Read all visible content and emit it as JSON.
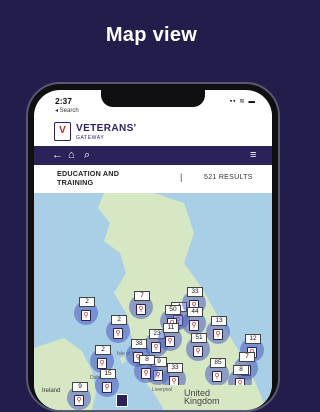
{
  "page_title": "Map view",
  "status_bar": {
    "time": "2:37",
    "back_label": "◂ Search",
    "icons": "▪▪ ≋ ▬"
  },
  "brand": {
    "name": "VETERANS'",
    "sub": "GATEWAY"
  },
  "nav": {
    "back": "←",
    "home": "⌂",
    "search": "⌕",
    "menu": "≡"
  },
  "filter": {
    "category": "EDUCATION AND TRAINING",
    "divider": "|",
    "results": "521 RESULTS"
  },
  "map": {
    "labels": {
      "isle_of_man": "Isle of Man",
      "dublin": "Dublin",
      "ireland": "Ireland",
      "liverpool": "Liverpool",
      "united_kingdom": "United\nKingdom"
    },
    "clusters": [
      {
        "count": "2"
      },
      {
        "count": "7"
      },
      {
        "count": "4"
      },
      {
        "count": "2"
      },
      {
        "count": "23"
      },
      {
        "count": "38"
      },
      {
        "count": "2"
      },
      {
        "count": "9"
      },
      {
        "count": "15"
      },
      {
        "count": "9"
      },
      {
        "count": "33"
      },
      {
        "count": "50"
      },
      {
        "count": "44"
      },
      {
        "count": "11"
      },
      {
        "count": "13"
      },
      {
        "count": "51"
      },
      {
        "count": "12"
      },
      {
        "count": "8"
      },
      {
        "count": "33"
      },
      {
        "count": "85"
      },
      {
        "count": "7"
      },
      {
        "count": "8"
      }
    ]
  }
}
